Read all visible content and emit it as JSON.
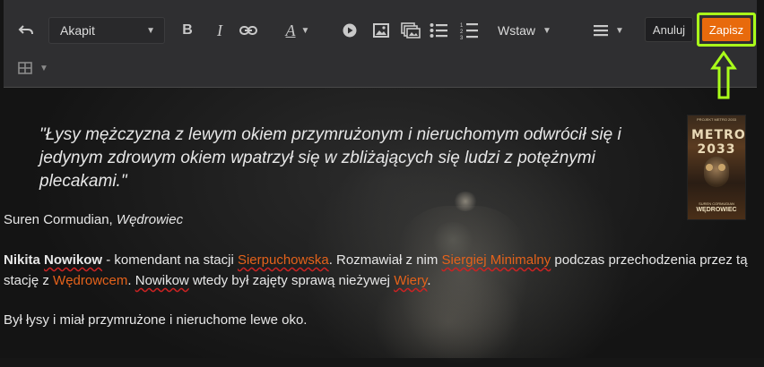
{
  "toolbar": {
    "paragraph_style": "Akapit",
    "bold_label": "B",
    "italic_label": "I",
    "font_color_label": "A",
    "insert_label": "Wstaw",
    "cancel_label": "Anuluj",
    "save_label": "Zapisz",
    "highlight_color": "#aaff1a",
    "save_color": "#e86a0c"
  },
  "content": {
    "quote": "\"Łysy mężczyzna z lewym okiem przymrużonym i nieruchomym odwrócił się i jedynym zdrowym okiem wpatrzył się w zbliżających się ludzi z potężnymi plecakami.\"",
    "author_name": "Suren Cormudian, ",
    "author_book": "Wędrowiec",
    "p1": {
      "name_first": "Nikita",
      "name_last": "Nowikow",
      "t1": " - komendant na stacji ",
      "link_station": "Sierpuchowska",
      "t2": ". Rozmawiał z nim ",
      "link_person": "Siergiej Minimalny",
      "t3": " podczas przechodzenia przez tą stację z ",
      "link_wanderer": "Wędrowcem",
      "t4": ". ",
      "name_repeat": "Nowikow",
      "t5": " wtedy był zajęty sprawą nieżywej ",
      "link_vera": "Wiery",
      "t6": "."
    },
    "p2": "Był łysy i miał przymrużone i nieruchome lewe oko.",
    "link_color": "#e4621b"
  },
  "book_cover": {
    "top_text": "PROJEKT METRO 2033",
    "title": "METRO 2033",
    "author": "SUREN CORMUDIAN",
    "subtitle": "WĘDROWIEC"
  }
}
